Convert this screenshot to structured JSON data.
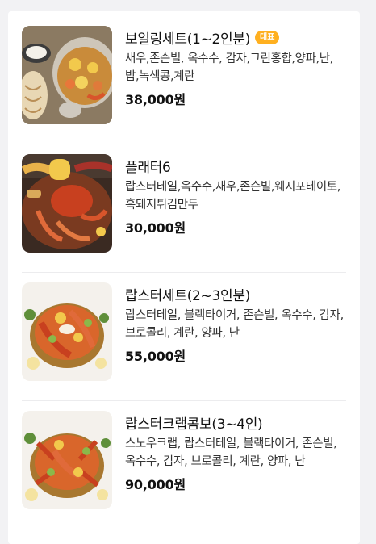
{
  "menu": {
    "items": [
      {
        "name": "보일링세트(1~2인분)",
        "badge": "대표",
        "description": "새우,존슨빌, 옥수수, 감자,그린홍합,양파,난,밥,녹색콩,계란",
        "price": "38,000원"
      },
      {
        "name": "플래터6",
        "description": "랍스터테일,옥수수,새우,존슨빌,웨지포테이토,흑돼지튀김만두",
        "price": "30,000원"
      },
      {
        "name": "랍스터세트(2~3인분)",
        "description": "랍스터테일, 블랙타이거, 존슨빌, 옥수수, 감자, 브로콜리, 계란, 양파, 난",
        "price": "55,000원"
      },
      {
        "name": "랍스터크랩콤보(3~4인)",
        "description": "스노우크랩, 랍스터테일, 블랙타이거, 존슨빌, 옥수수, 감자, 브로콜리, 계란, 양파, 난",
        "price": "90,000원"
      }
    ]
  }
}
